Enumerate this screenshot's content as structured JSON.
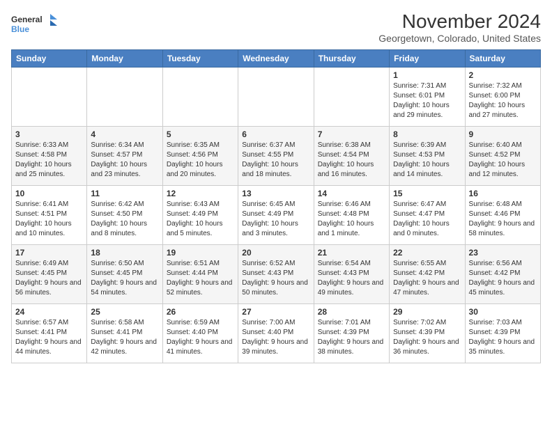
{
  "header": {
    "logo_line1": "General",
    "logo_line2": "Blue",
    "title": "November 2024",
    "subtitle": "Georgetown, Colorado, United States"
  },
  "days_of_week": [
    "Sunday",
    "Monday",
    "Tuesday",
    "Wednesday",
    "Thursday",
    "Friday",
    "Saturday"
  ],
  "weeks": [
    [
      {
        "day": "",
        "data": ""
      },
      {
        "day": "",
        "data": ""
      },
      {
        "day": "",
        "data": ""
      },
      {
        "day": "",
        "data": ""
      },
      {
        "day": "",
        "data": ""
      },
      {
        "day": "1",
        "data": "Sunrise: 7:31 AM\nSunset: 6:01 PM\nDaylight: 10 hours and 29 minutes."
      },
      {
        "day": "2",
        "data": "Sunrise: 7:32 AM\nSunset: 6:00 PM\nDaylight: 10 hours and 27 minutes."
      }
    ],
    [
      {
        "day": "3",
        "data": "Sunrise: 6:33 AM\nSunset: 4:58 PM\nDaylight: 10 hours and 25 minutes."
      },
      {
        "day": "4",
        "data": "Sunrise: 6:34 AM\nSunset: 4:57 PM\nDaylight: 10 hours and 23 minutes."
      },
      {
        "day": "5",
        "data": "Sunrise: 6:35 AM\nSunset: 4:56 PM\nDaylight: 10 hours and 20 minutes."
      },
      {
        "day": "6",
        "data": "Sunrise: 6:37 AM\nSunset: 4:55 PM\nDaylight: 10 hours and 18 minutes."
      },
      {
        "day": "7",
        "data": "Sunrise: 6:38 AM\nSunset: 4:54 PM\nDaylight: 10 hours and 16 minutes."
      },
      {
        "day": "8",
        "data": "Sunrise: 6:39 AM\nSunset: 4:53 PM\nDaylight: 10 hours and 14 minutes."
      },
      {
        "day": "9",
        "data": "Sunrise: 6:40 AM\nSunset: 4:52 PM\nDaylight: 10 hours and 12 minutes."
      }
    ],
    [
      {
        "day": "10",
        "data": "Sunrise: 6:41 AM\nSunset: 4:51 PM\nDaylight: 10 hours and 10 minutes."
      },
      {
        "day": "11",
        "data": "Sunrise: 6:42 AM\nSunset: 4:50 PM\nDaylight: 10 hours and 8 minutes."
      },
      {
        "day": "12",
        "data": "Sunrise: 6:43 AM\nSunset: 4:49 PM\nDaylight: 10 hours and 5 minutes."
      },
      {
        "day": "13",
        "data": "Sunrise: 6:45 AM\nSunset: 4:49 PM\nDaylight: 10 hours and 3 minutes."
      },
      {
        "day": "14",
        "data": "Sunrise: 6:46 AM\nSunset: 4:48 PM\nDaylight: 10 hours and 1 minute."
      },
      {
        "day": "15",
        "data": "Sunrise: 6:47 AM\nSunset: 4:47 PM\nDaylight: 10 hours and 0 minutes."
      },
      {
        "day": "16",
        "data": "Sunrise: 6:48 AM\nSunset: 4:46 PM\nDaylight: 9 hours and 58 minutes."
      }
    ],
    [
      {
        "day": "17",
        "data": "Sunrise: 6:49 AM\nSunset: 4:45 PM\nDaylight: 9 hours and 56 minutes."
      },
      {
        "day": "18",
        "data": "Sunrise: 6:50 AM\nSunset: 4:45 PM\nDaylight: 9 hours and 54 minutes."
      },
      {
        "day": "19",
        "data": "Sunrise: 6:51 AM\nSunset: 4:44 PM\nDaylight: 9 hours and 52 minutes."
      },
      {
        "day": "20",
        "data": "Sunrise: 6:52 AM\nSunset: 4:43 PM\nDaylight: 9 hours and 50 minutes."
      },
      {
        "day": "21",
        "data": "Sunrise: 6:54 AM\nSunset: 4:43 PM\nDaylight: 9 hours and 49 minutes."
      },
      {
        "day": "22",
        "data": "Sunrise: 6:55 AM\nSunset: 4:42 PM\nDaylight: 9 hours and 47 minutes."
      },
      {
        "day": "23",
        "data": "Sunrise: 6:56 AM\nSunset: 4:42 PM\nDaylight: 9 hours and 45 minutes."
      }
    ],
    [
      {
        "day": "24",
        "data": "Sunrise: 6:57 AM\nSunset: 4:41 PM\nDaylight: 9 hours and 44 minutes."
      },
      {
        "day": "25",
        "data": "Sunrise: 6:58 AM\nSunset: 4:41 PM\nDaylight: 9 hours and 42 minutes."
      },
      {
        "day": "26",
        "data": "Sunrise: 6:59 AM\nSunset: 4:40 PM\nDaylight: 9 hours and 41 minutes."
      },
      {
        "day": "27",
        "data": "Sunrise: 7:00 AM\nSunset: 4:40 PM\nDaylight: 9 hours and 39 minutes."
      },
      {
        "day": "28",
        "data": "Sunrise: 7:01 AM\nSunset: 4:39 PM\nDaylight: 9 hours and 38 minutes."
      },
      {
        "day": "29",
        "data": "Sunrise: 7:02 AM\nSunset: 4:39 PM\nDaylight: 9 hours and 36 minutes."
      },
      {
        "day": "30",
        "data": "Sunrise: 7:03 AM\nSunset: 4:39 PM\nDaylight: 9 hours and 35 minutes."
      }
    ]
  ]
}
